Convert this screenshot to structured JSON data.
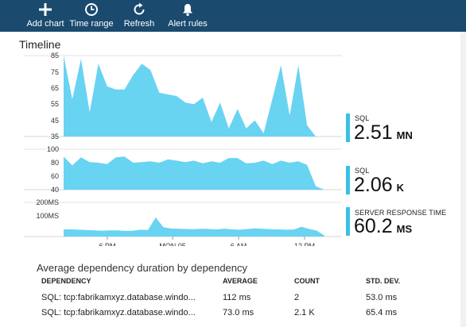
{
  "toolbar": {
    "add_chart": "Add chart",
    "time_range": "Time range",
    "refresh": "Refresh",
    "alert_rules": "Alert rules"
  },
  "timeline": {
    "title": "Timeline"
  },
  "colors": {
    "toolbar_bg": "#1a4a6e",
    "series_fill": "#69d3f2",
    "accent": "#39c0e6"
  },
  "chart_data": [
    {
      "type": "area",
      "ylabel": "",
      "y_tick_labels": [
        "85",
        "75",
        "65",
        "55",
        "45",
        "35"
      ],
      "ylim": [
        35,
        85
      ],
      "values": [
        85,
        58,
        83,
        50,
        80,
        66,
        64,
        64,
        73,
        80,
        76,
        62,
        61,
        60,
        56,
        55,
        59,
        44,
        56,
        40,
        52,
        40,
        45,
        37,
        58,
        79,
        48,
        79,
        42,
        35,
        35
      ]
    },
    {
      "type": "area",
      "ylabel": "",
      "y_tick_labels": [
        "100",
        "80",
        "60",
        "40"
      ],
      "ylim": [
        40,
        100
      ],
      "values": [
        89,
        76,
        88,
        81,
        80,
        78,
        88,
        89,
        80,
        81,
        82,
        80,
        85,
        83,
        81,
        83,
        79,
        82,
        80,
        87,
        87,
        79,
        80,
        83,
        78,
        83,
        80,
        82,
        77,
        45,
        40
      ]
    },
    {
      "type": "area",
      "ylabel": "",
      "y_tick_labels": [
        "200MS",
        "100MS"
      ],
      "ylim": [
        0,
        200
      ],
      "x_tick_labels": [
        "6 PM",
        "MON 05",
        "6 AM",
        "12 PM"
      ],
      "values": [
        42,
        42,
        40,
        38,
        36,
        34,
        36,
        36,
        33,
        34,
        40,
        38,
        112,
        55,
        47,
        45,
        44,
        43,
        45,
        44,
        42,
        46,
        42,
        40,
        44,
        48,
        45,
        43,
        42,
        40,
        41,
        57,
        44,
        35,
        5
      ]
    }
  ],
  "metrics": [
    {
      "label": "SQL",
      "value": "2.51",
      "unit": "MN"
    },
    {
      "label": "SQL",
      "value": "2.06",
      "unit": "K"
    },
    {
      "label": "SERVER RESPONSE TIME",
      "value": "60.2",
      "unit": "MS"
    }
  ],
  "dependency_table": {
    "title": "Average dependency duration by dependency",
    "headers": [
      "DEPENDENCY",
      "AVERAGE",
      "COUNT",
      "STD. DEV."
    ],
    "rows": [
      [
        "SQL: tcp:fabrikamxyz.database.windo...",
        "112 ms",
        "2",
        "53.0 ms"
      ],
      [
        "SQL: tcp:fabrikamxyz.database.windo...",
        "73.0 ms",
        "2.1 K",
        "65.4 ms"
      ]
    ]
  }
}
